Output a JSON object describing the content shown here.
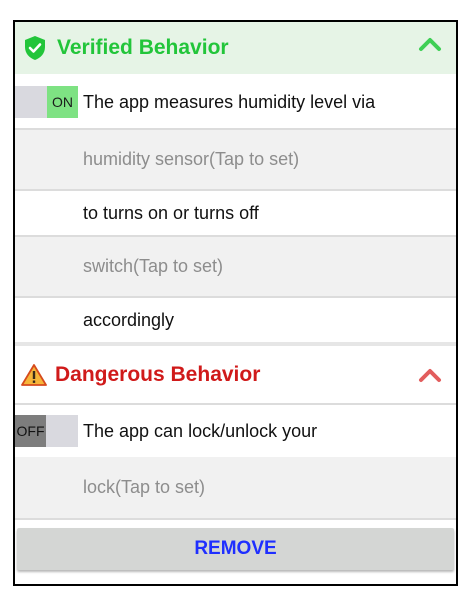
{
  "verified": {
    "title": "Verified Behavior",
    "toggle_label": "ON",
    "rows": [
      "The app measures humidity level via",
      "humidity sensor(Tap to set)",
      "to turns on or turns off",
      "switch(Tap to set)",
      "accordingly"
    ],
    "color": "#22c53a",
    "header_bg": "#e6f4e6"
  },
  "dangerous": {
    "title": "Dangerous Behavior",
    "toggle_label": "OFF",
    "rows": [
      "The app can lock/unlock your",
      "lock(Tap to set)"
    ],
    "color": "#d01a1a"
  },
  "actions": {
    "remove_label": "REMOVE"
  },
  "icons": [
    "shield-check-icon",
    "chevron-up-icon",
    "warning-icon"
  ]
}
